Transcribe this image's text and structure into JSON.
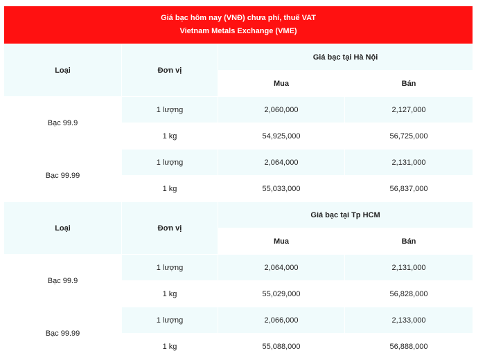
{
  "colors": {
    "title_bg": "#ff1111",
    "row_tint": "#f0fbfc",
    "row_white": "#ffffff"
  },
  "title": {
    "line1": "Giá bạc hôm nay (VNĐ) chưa phí, thuế VAT",
    "line2": "Vietnam Metals Exchange (VME)"
  },
  "sections": [
    {
      "headers": {
        "type": "Loại",
        "unit": "Đơn vị",
        "location": "Giá bạc tại Hà Nội",
        "buy": "Mua",
        "sell": "Bán"
      },
      "products": [
        {
          "name": "Bạc 99.9",
          "rows": [
            {
              "unit": "1 lượng",
              "buy": "2,060,000",
              "sell": "2,127,000"
            },
            {
              "unit": "1 kg",
              "buy": "54,925,000",
              "sell": "56,725,000"
            }
          ]
        },
        {
          "name": "Bạc 99.99",
          "rows": [
            {
              "unit": "1 lượng",
              "buy": "2,064,000",
              "sell": "2,131,000"
            },
            {
              "unit": "1 kg",
              "buy": "55,033,000",
              "sell": "56,837,000"
            }
          ]
        }
      ]
    },
    {
      "headers": {
        "type": "Loại",
        "unit": "Đơn vị",
        "location": "Giá bạc tại Tp HCM",
        "buy": "Mua",
        "sell": "Bán"
      },
      "products": [
        {
          "name": "Bạc 99.9",
          "rows": [
            {
              "unit": "1 lượng",
              "buy": "2,064,000",
              "sell": "2,131,000"
            },
            {
              "unit": "1 kg",
              "buy": "55,029,000",
              "sell": "56,828,000"
            }
          ]
        },
        {
          "name": "Bạc 99.99",
          "rows": [
            {
              "unit": "1 lượng",
              "buy": "2,066,000",
              "sell": "2,133,000"
            },
            {
              "unit": "1 kg",
              "buy": "55,088,000",
              "sell": "56,888,000"
            }
          ]
        }
      ]
    }
  ]
}
